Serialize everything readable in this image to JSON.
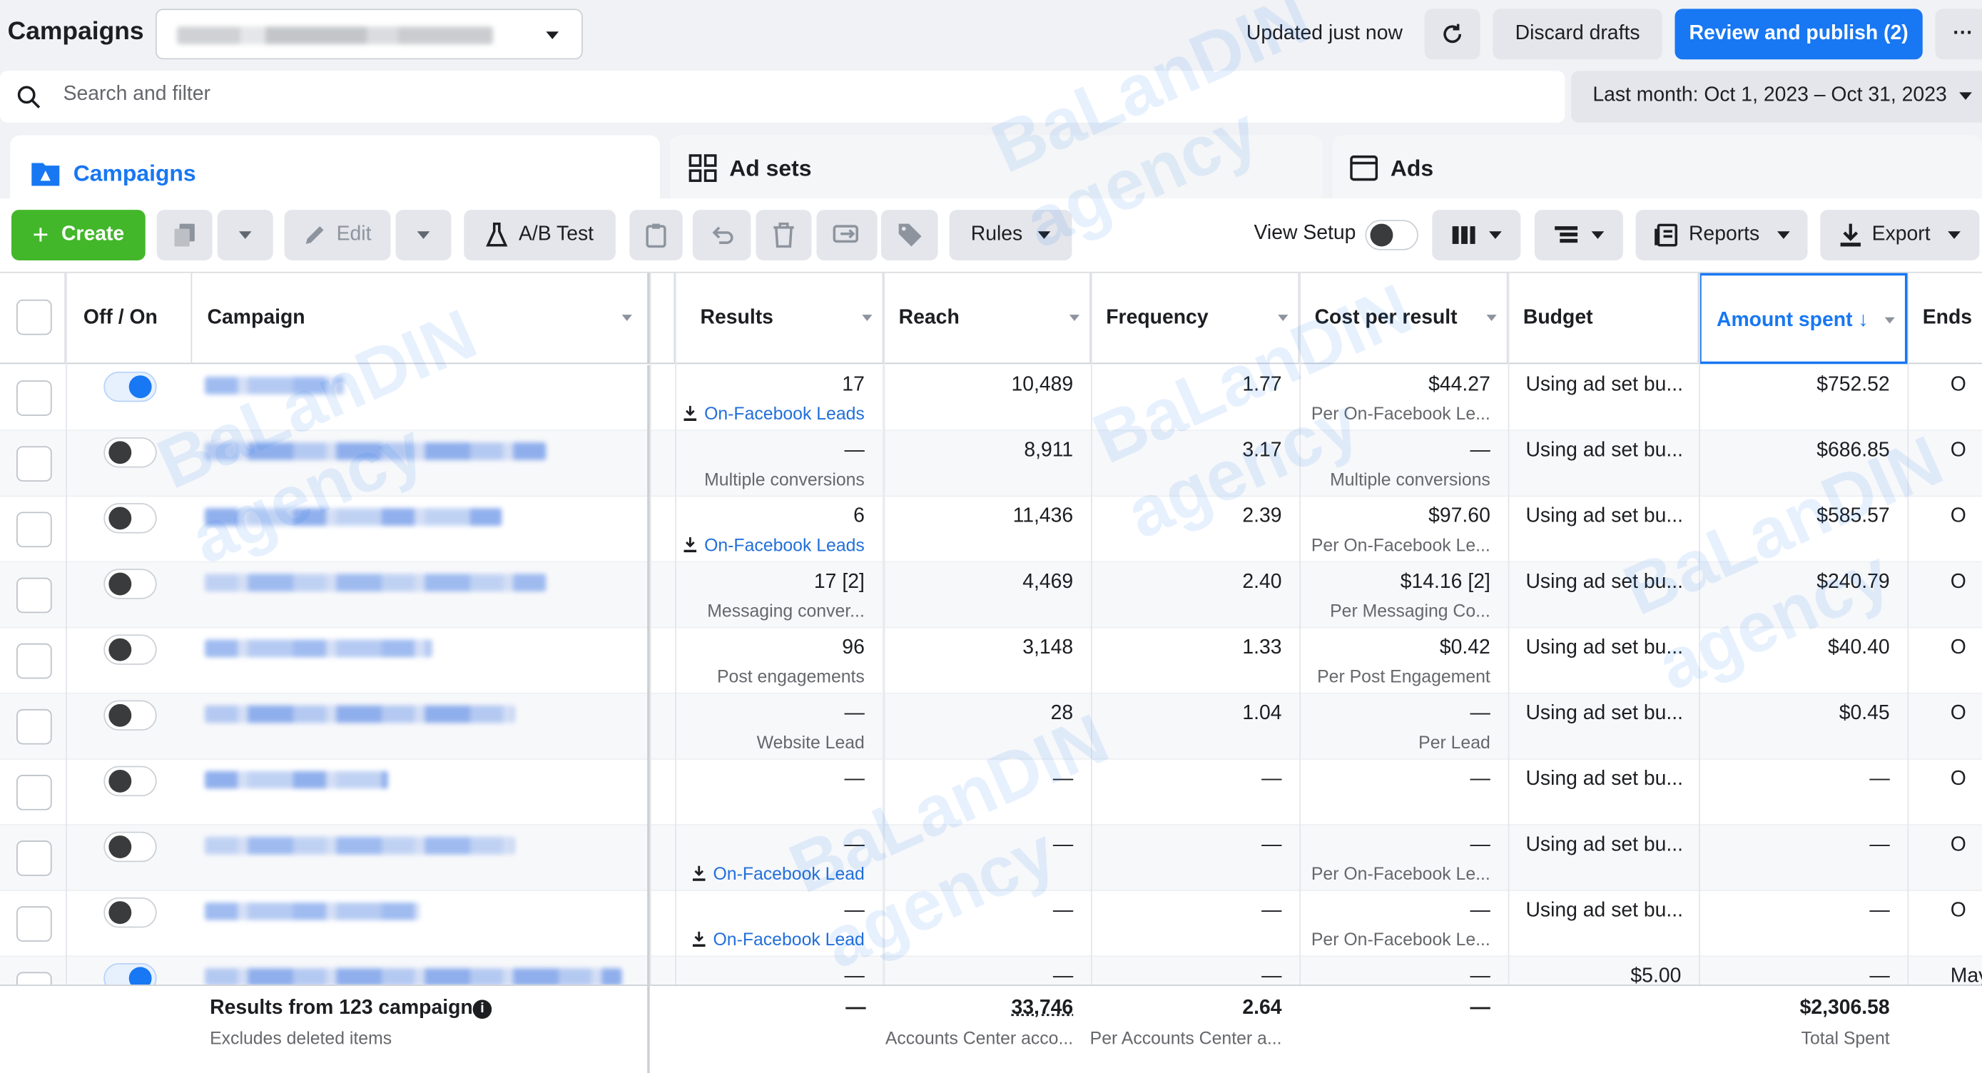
{
  "header": {
    "title": "Campaigns",
    "updated": "Updated just now",
    "discard": "Discard drafts",
    "publish": "Review and publish (2)",
    "more": "···"
  },
  "search": {
    "placeholder": "Search and filter"
  },
  "date_range": "Last month: Oct 1, 2023 – Oct 31, 2023",
  "tabs": [
    {
      "label": "Campaigns",
      "icon": "campaign-icon"
    },
    {
      "label": "Ad sets",
      "icon": "grid-icon"
    },
    {
      "label": "Ads",
      "icon": "ad-icon"
    }
  ],
  "toolbar": {
    "create": "Create",
    "edit": "Edit",
    "ab_test": "A/B Test",
    "rules": "Rules",
    "view_setup": "View Setup",
    "reports": "Reports",
    "export": "Export"
  },
  "columns": {
    "off_on": "Off / On",
    "campaign": "Campaign",
    "results": "Results",
    "reach": "Reach",
    "frequency": "Frequency",
    "cost_per_result": "Cost per result",
    "budget": "Budget",
    "amount_spent": "Amount spent ↓",
    "ends": "Ends"
  },
  "rows": [
    {
      "on": true,
      "results": "17",
      "results_sub": "On-Facebook Leads",
      "results_link": true,
      "reach": "10,489",
      "frequency": "1.77",
      "cost": "$44.27",
      "cost_sub": "Per On-Facebook Le...",
      "budget": "Using ad set bu...",
      "spent": "$752.52",
      "ends": "O"
    },
    {
      "on": false,
      "results": "—",
      "results_sub": "Multiple conversions",
      "results_link": false,
      "reach": "8,911",
      "frequency": "3.17",
      "cost": "—",
      "cost_sub": "Multiple conversions",
      "budget": "Using ad set bu...",
      "spent": "$686.85",
      "ends": "O"
    },
    {
      "on": false,
      "results": "6",
      "results_sub": "On-Facebook Leads",
      "results_link": true,
      "reach": "11,436",
      "frequency": "2.39",
      "cost": "$97.60",
      "cost_sub": "Per On-Facebook Le...",
      "budget": "Using ad set bu...",
      "spent": "$585.57",
      "ends": "O"
    },
    {
      "on": false,
      "results": "17 [2]",
      "results_sub": "Messaging conver...",
      "results_link": false,
      "reach": "4,469",
      "frequency": "2.40",
      "cost": "$14.16 [2]",
      "cost_sub": "Per Messaging Co...",
      "budget": "Using ad set bu...",
      "spent": "$240.79",
      "ends": "O"
    },
    {
      "on": false,
      "results": "96",
      "results_sub": "Post engagements",
      "results_link": false,
      "reach": "3,148",
      "frequency": "1.33",
      "cost": "$0.42",
      "cost_sub": "Per Post Engagement",
      "budget": "Using ad set bu...",
      "spent": "$40.40",
      "ends": "O"
    },
    {
      "on": false,
      "results": "—",
      "results_sub": "Website Lead",
      "results_link": false,
      "reach": "28",
      "frequency": "1.04",
      "cost": "—",
      "cost_sub": "Per Lead",
      "budget": "Using ad set bu...",
      "spent": "$0.45",
      "ends": "O"
    },
    {
      "on": false,
      "results": "—",
      "results_sub": "",
      "results_link": false,
      "reach": "—",
      "frequency": "—",
      "cost": "—",
      "cost_sub": "",
      "budget": "Using ad set bu...",
      "spent": "—",
      "ends": "O"
    },
    {
      "on": false,
      "results": "—",
      "results_sub": "On-Facebook Lead",
      "results_link": true,
      "reach": "—",
      "frequency": "—",
      "cost": "—",
      "cost_sub": "Per On-Facebook Le...",
      "budget": "Using ad set bu...",
      "spent": "—",
      "ends": "O"
    },
    {
      "on": false,
      "results": "—",
      "results_sub": "On-Facebook Lead",
      "results_link": true,
      "reach": "—",
      "frequency": "—",
      "cost": "—",
      "cost_sub": "Per On-Facebook Le...",
      "budget": "Using ad set bu...",
      "spent": "—",
      "ends": "O"
    },
    {
      "on": true,
      "results": "—",
      "results_sub": "",
      "results_link": false,
      "reach": "—",
      "frequency": "—",
      "cost": "—",
      "cost_sub": "",
      "budget": "$5.00",
      "spent": "—",
      "ends": "May"
    }
  ],
  "footer": {
    "title": "Results from 123 campaigns",
    "subtitle": "Excludes deleted items",
    "results": "—",
    "reach": "33,746",
    "reach_sub": "Accounts Center acco...",
    "frequency": "2.64",
    "frequency_sub": "Per Accounts Center a...",
    "cost": "—",
    "spent": "$2,306.58",
    "spent_sub": "Total Spent"
  },
  "watermark": [
    "BaLanDIN",
    "agency"
  ],
  "colors": {
    "accent": "#1877f2",
    "create": "#42b72a",
    "link": "#216fdb"
  }
}
